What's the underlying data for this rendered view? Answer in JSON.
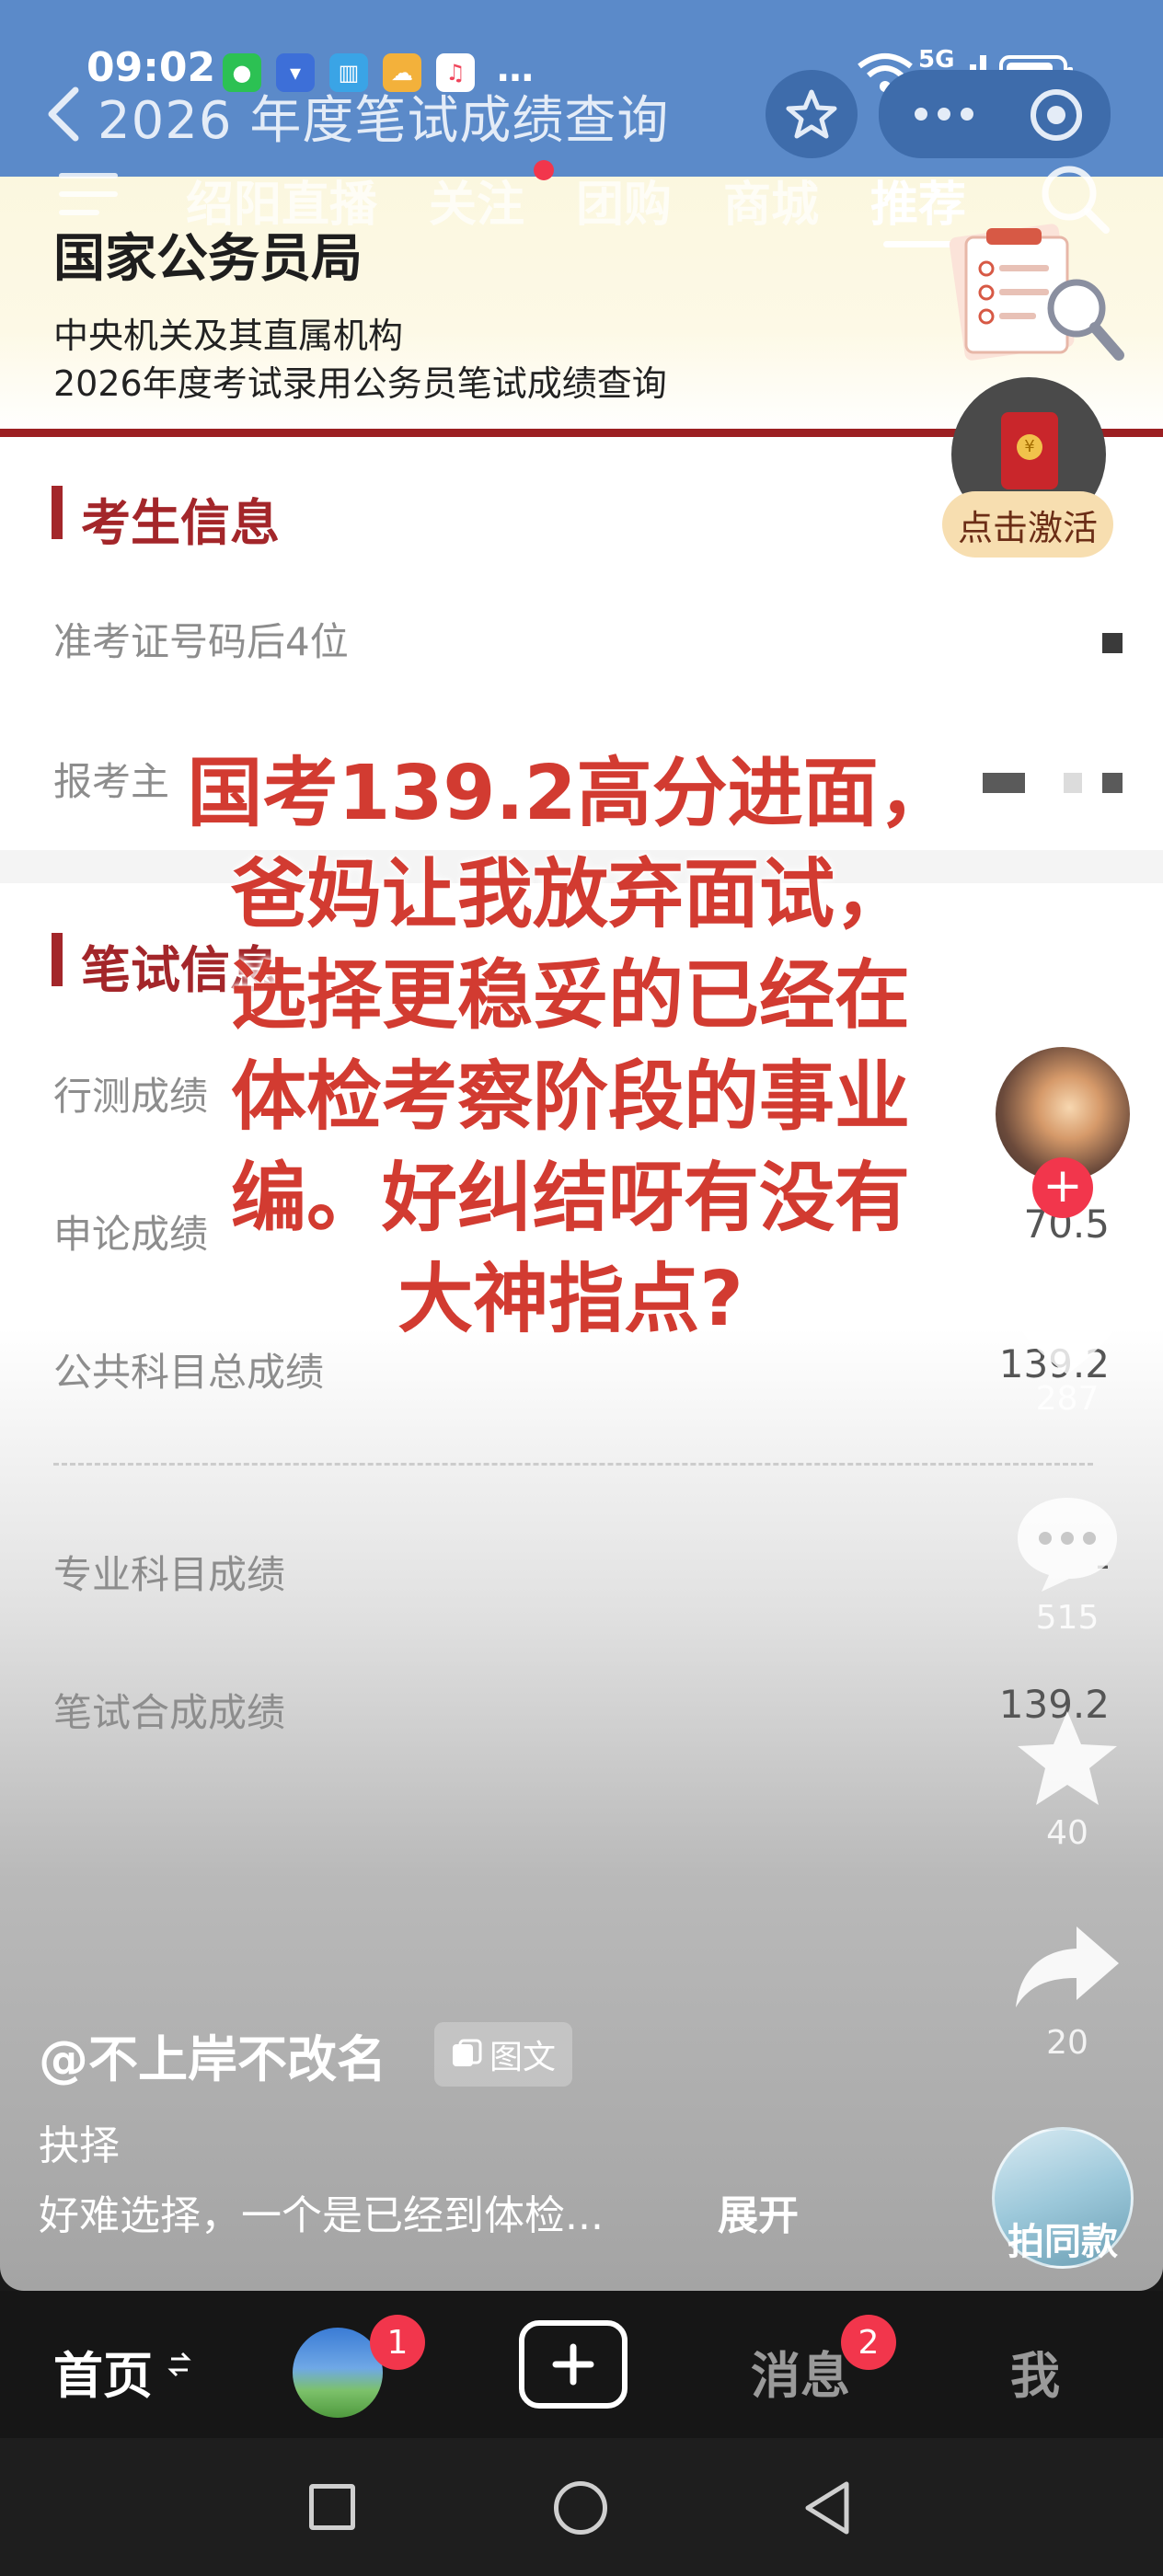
{
  "status_bar": {
    "time": "09:02",
    "network": "5G",
    "more": "…"
  },
  "mini_program": {
    "title": "2026 年度笔试成绩查询"
  },
  "top_tabs": [
    {
      "label": "绍阳"
    },
    {
      "label": "直播"
    },
    {
      "label": "关注"
    },
    {
      "label": "团购"
    },
    {
      "label": "商城"
    },
    {
      "label": "推荐"
    }
  ],
  "banner": {
    "bureau": "国家公务员局",
    "line1": "中央机关及其直属机构",
    "line2": "2026年度考试录用公务员笔试成绩查询"
  },
  "activate_label": "点击激活",
  "candidate_section": {
    "title": "考生信息",
    "fields": [
      {
        "label": "准考证号码后4位"
      },
      {
        "label": "报考主"
      }
    ]
  },
  "exam_section": {
    "title": "笔试信息",
    "rows": [
      {
        "label": "行测成绩",
        "value": ""
      },
      {
        "label": "申论成绩",
        "value": "70.5"
      },
      {
        "label": "公共科目总成绩",
        "value": "139.2"
      },
      {
        "label": "专业科目成绩",
        "value": "-"
      },
      {
        "label": "笔试合成成绩",
        "value": "139.2"
      }
    ]
  },
  "caption": "国考139.2高分进面，\n爸妈让我放弃面试，\n选择更稳妥的已经在\n体检考察阶段的事业\n编。好纠结呀有没有\n大神指点?",
  "actions": {
    "likes": "287",
    "comments": "515",
    "favorites": "40",
    "shares": "20",
    "same_style": "拍同款"
  },
  "post": {
    "author": "@不上岸不改名",
    "type_tag": "图文",
    "title": "抉择",
    "description": "好难选择，一个是已经到体检...",
    "expand": "展开"
  },
  "bottom_nav": {
    "home": "首页",
    "friends_badge": "1",
    "messages": "消息",
    "messages_badge": "2",
    "me": "我"
  },
  "colors": {
    "accent_red": "#a3262a",
    "caption_red": "#d23b31",
    "header_blue": "#5b8ac9",
    "badge_red": "#f2364c"
  }
}
